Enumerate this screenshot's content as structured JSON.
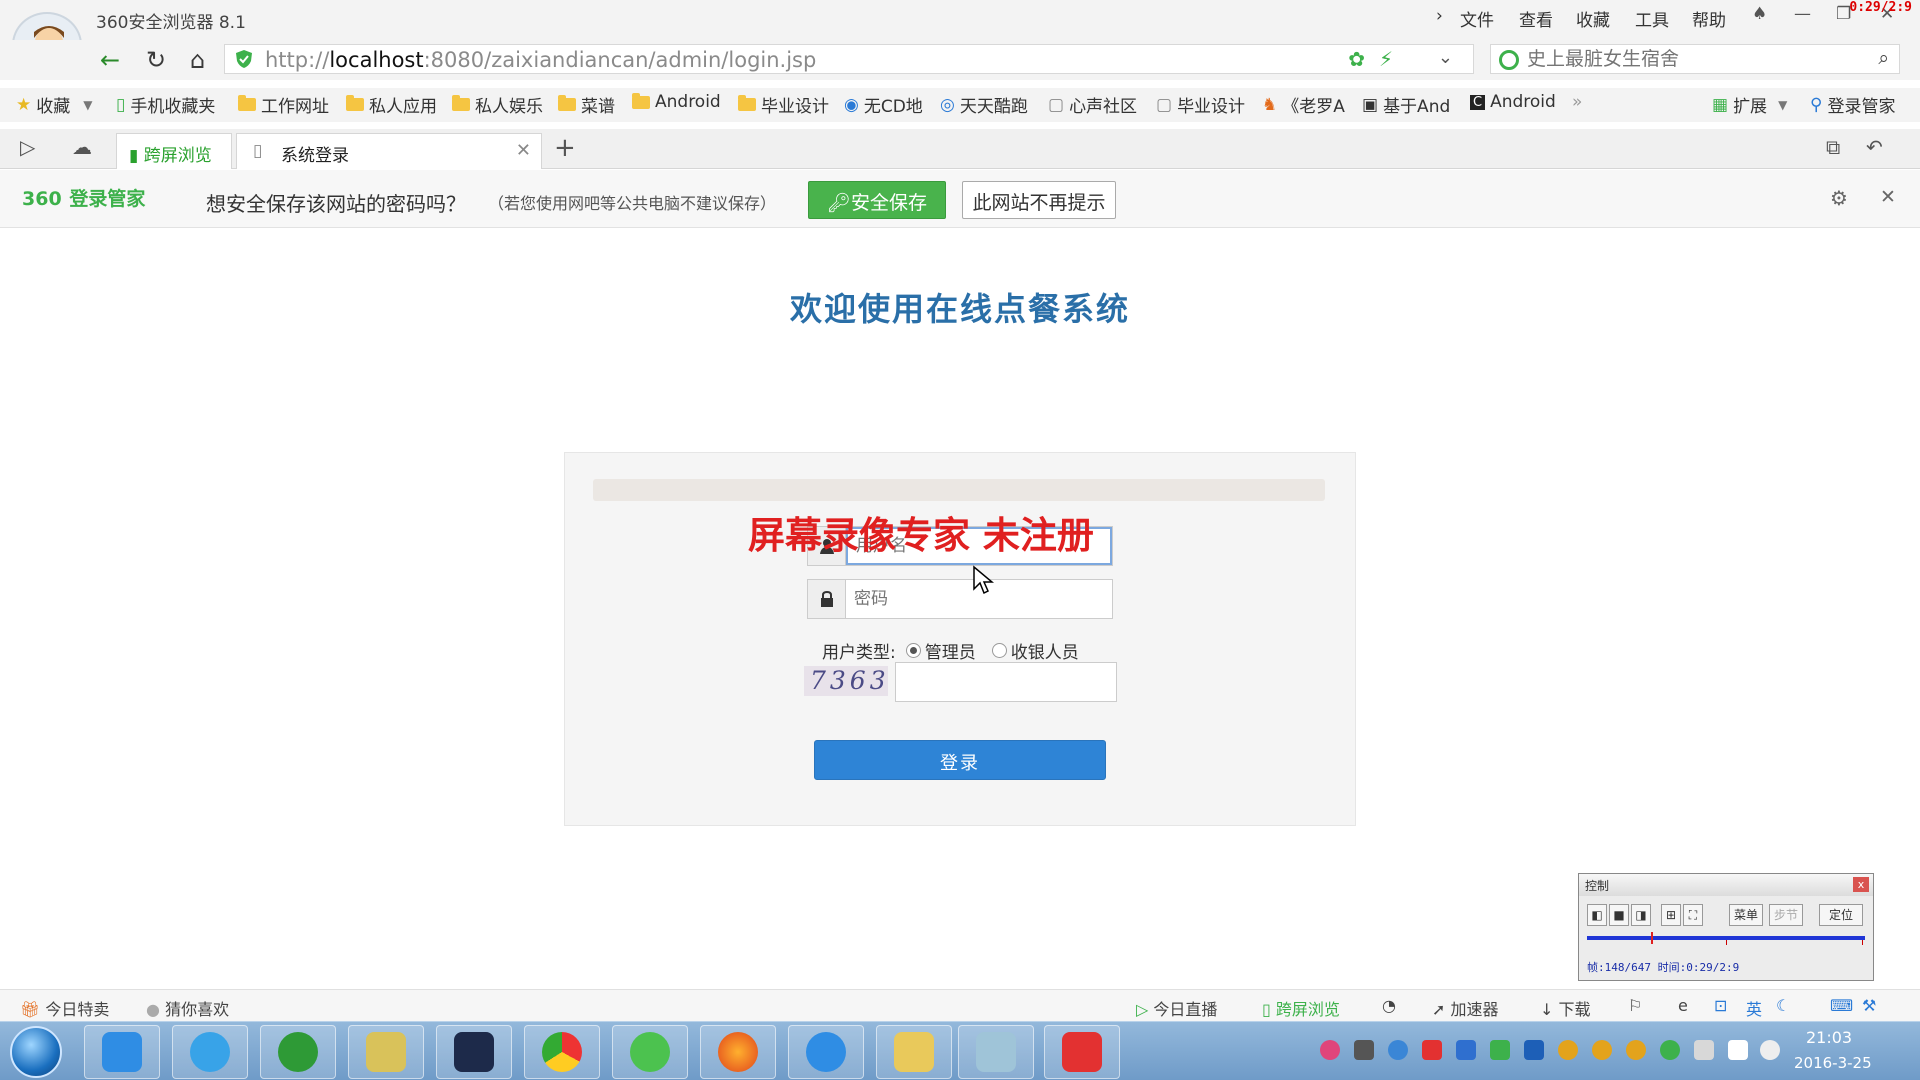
{
  "window": {
    "app_title": "360安全浏览器 8.1",
    "recorder_time": "0:29/2:9",
    "menu": [
      "文件",
      "查看",
      "收藏",
      "工具",
      "帮助"
    ]
  },
  "address_bar": {
    "url_prefix": "http://",
    "url_host": "localhost",
    "url_rest": ":8080/zaixiandiancan/admin/login.jsp",
    "search_placeholder": "史上最脏女生宿舍"
  },
  "bookmarks": [
    {
      "label": "收藏",
      "icon": "star-icon"
    },
    {
      "label": "手机收藏夹",
      "icon": "phone-icon"
    },
    {
      "label": "工作网址",
      "icon": "folder-icon"
    },
    {
      "label": "私人应用",
      "icon": "folder-icon"
    },
    {
      "label": "私人娱乐",
      "icon": "folder-icon"
    },
    {
      "label": "菜谱",
      "icon": "folder-icon"
    },
    {
      "label": "Android",
      "icon": "folder-icon"
    },
    {
      "label": "毕业设计",
      "icon": "folder-icon"
    },
    {
      "label": "无CD地",
      "icon": "cd-icon"
    },
    {
      "label": "天天酷跑",
      "icon": "game-icon"
    },
    {
      "label": "心声社区",
      "icon": "page-icon"
    },
    {
      "label": "毕业设计",
      "icon": "page-icon"
    },
    {
      "label": "《老罗A",
      "icon": "fox-icon"
    },
    {
      "label": "基于And",
      "icon": "page-icon"
    },
    {
      "label": "Android",
      "icon": "c-icon"
    }
  ],
  "bookmarks_right": {
    "extensions": "扩展",
    "login_manager": "登录管家"
  },
  "tabs": {
    "cross_screen": "跨屏浏览",
    "active_tab": "系统登录"
  },
  "password_bar": {
    "logo_num": "360",
    "logo_text": "登录管家",
    "question": "想安全保存该网站的密码吗？",
    "note": "（若您使用网吧等公共电脑不建议保存）",
    "save_button": "安全保存",
    "never_button": "此网站不再提示"
  },
  "page": {
    "heading": "欢迎使用在线点餐系统",
    "watermark": "屏幕录像专家  未注册",
    "username_placeholder": "用户名",
    "password_placeholder": "密码",
    "user_type_label": "用户类型:",
    "user_type_options": [
      "管理员",
      "收银人员"
    ],
    "user_type_selected": "管理员",
    "captcha_text": "7363",
    "login_button": "登录"
  },
  "recorder_control": {
    "title": "控制",
    "menu_button": "菜单",
    "step_button": "步节",
    "locate_button": "定位",
    "status": "帧:148/647 时间:0:29/2:9",
    "progress": 0.229
  },
  "status_bar": {
    "left": [
      "今日特卖",
      "猜你喜欢"
    ],
    "right": [
      "今日直播",
      "跨屏浏览",
      "加速器",
      "下载"
    ],
    "ime": "英"
  },
  "taskbar": {
    "time": "21:03",
    "date": "2016-3-25"
  },
  "colors": {
    "accent_blue": "#2e84d6",
    "heading_blue": "#2a6fa8",
    "brand_green": "#49b34c",
    "watermark_red": "#e02020"
  }
}
